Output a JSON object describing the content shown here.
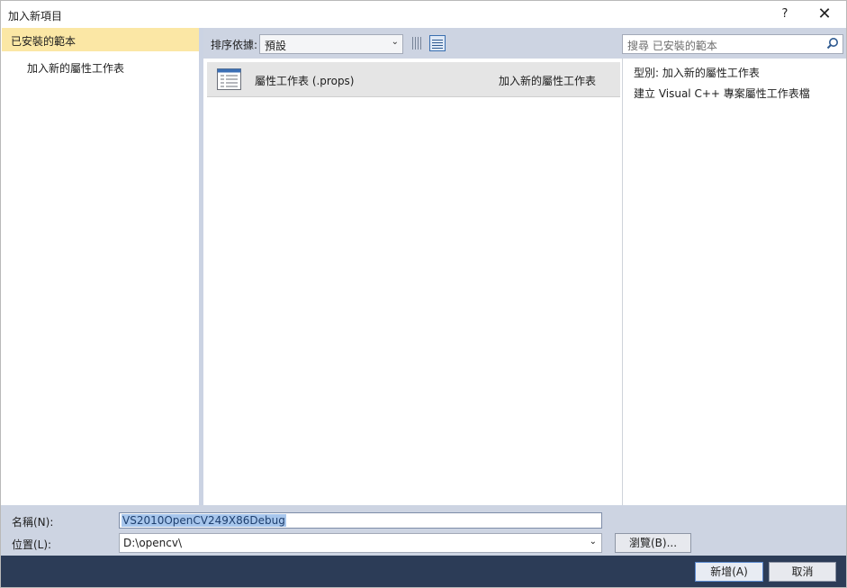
{
  "window": {
    "title": "加入新項目",
    "help_glyph": "?",
    "close_glyph": "✕"
  },
  "tree": {
    "header": "已安裝的範本",
    "items": [
      {
        "label": "加入新的屬性工作表"
      }
    ]
  },
  "toolbar": {
    "sort_label": "排序依據:",
    "sort_value": "預設",
    "sort_arrow": "⌄",
    "search_placeholder": "搜尋 已安裝的範本",
    "icons": [
      "small-icons-view-icon",
      "list-view-icon",
      "search-icon"
    ]
  },
  "templates": [
    {
      "name": "屬性工作表 (.props)",
      "category": "加入新的屬性工作表",
      "icon": "property-sheet-icon",
      "selected": true
    }
  ],
  "details": {
    "type_line": "型別:  加入新的屬性工作表",
    "description": "建立 Visual C++ 專案屬性工作表檔"
  },
  "form": {
    "name_label": "名稱(N):",
    "name_value": "VS2010OpenCV249X86Debug",
    "location_label": "位置(L):",
    "location_value": "D:\\opencv\\",
    "location_arrow": "⌄",
    "browse_label": "瀏覽(B)..."
  },
  "footer": {
    "ok_label": "新增(A)",
    "cancel_label": "取消"
  },
  "colors": {
    "accent_header": "#fbe7a5",
    "panel": "#cdd4e2",
    "footer": "#2c3c57",
    "selection": "#a7c6ec"
  }
}
